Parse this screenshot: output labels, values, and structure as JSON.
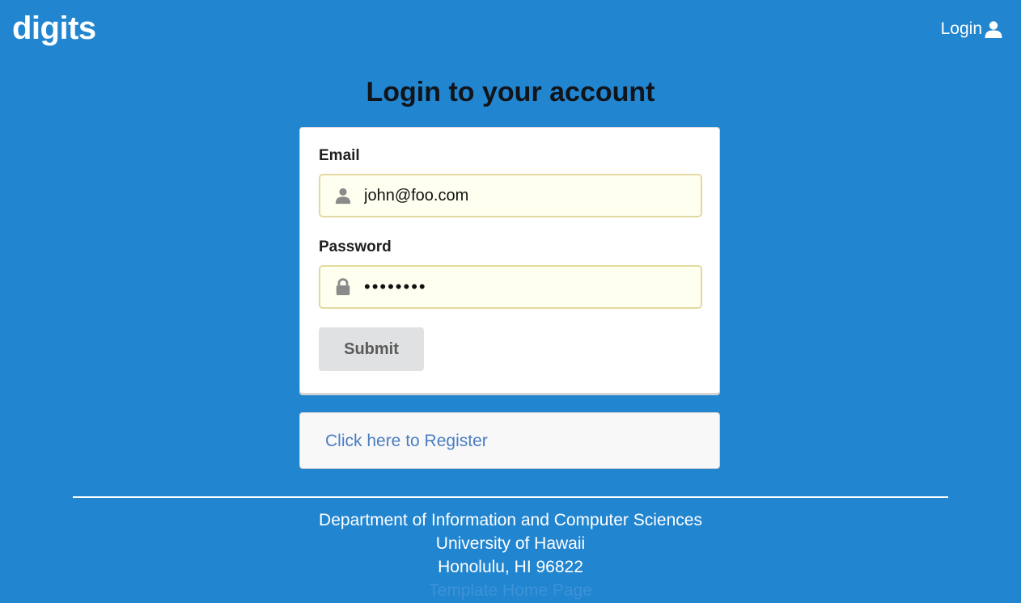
{
  "navbar": {
    "brand": "digits",
    "login_label": "Login",
    "login_icon": "user-icon"
  },
  "page": {
    "title": "Login to your account"
  },
  "form": {
    "email_label": "Email",
    "email_value": "john@foo.com",
    "email_icon": "user-icon",
    "password_label": "Password",
    "password_value": "password",
    "password_icon": "lock-icon",
    "submit_label": "Submit"
  },
  "register": {
    "link_text": "Click here to Register"
  },
  "footer": {
    "line1": "Department of Information and Computer Sciences",
    "line2": "University of Hawaii",
    "line3": "Honolulu, HI 96822",
    "line4": "Template Home Page"
  },
  "colors": {
    "background": "#2185d0",
    "input_bg": "#fffff0",
    "link": "#4a7dc0",
    "button_bg": "#e0e1e2"
  }
}
